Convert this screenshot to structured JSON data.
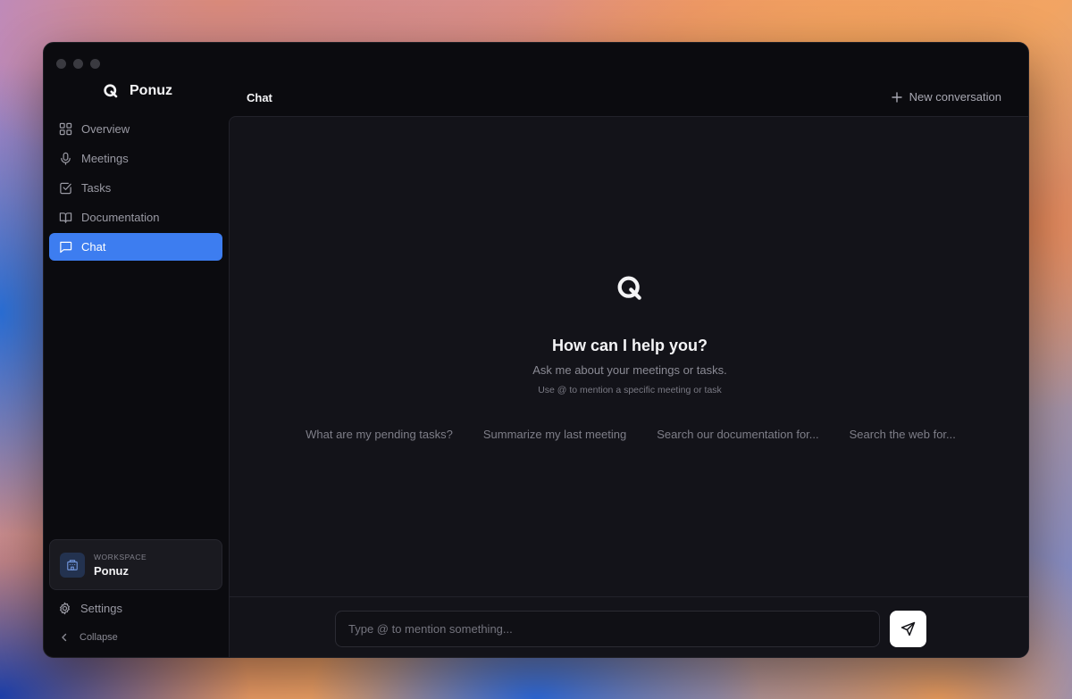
{
  "app": {
    "name": "Ponuz"
  },
  "sidebar": {
    "items": [
      {
        "label": "Overview",
        "icon": "grid-icon"
      },
      {
        "label": "Meetings",
        "icon": "microphone-icon"
      },
      {
        "label": "Tasks",
        "icon": "checkbox-icon"
      },
      {
        "label": "Documentation",
        "icon": "book-icon"
      },
      {
        "label": "Chat",
        "icon": "message-icon",
        "active": true
      }
    ],
    "workspace": {
      "label": "WORKSPACE",
      "name": "Ponuz"
    },
    "settings_label": "Settings",
    "collapse_label": "Collapse"
  },
  "header": {
    "title": "Chat",
    "new_conversation_label": "New conversation"
  },
  "hero": {
    "title": "How can I help you?",
    "subtitle": "Ask me about your meetings or tasks.",
    "hint": "Use @ to mention a specific meeting or task"
  },
  "suggestions": [
    "What are my pending tasks?",
    "Summarize my last meeting",
    "Search our documentation for...",
    "Search the web for..."
  ],
  "composer": {
    "placeholder": "Type @ to mention something..."
  },
  "colors": {
    "accent": "#3d7df0",
    "window_bg": "#0b0b0f",
    "main_bg": "#131319"
  }
}
